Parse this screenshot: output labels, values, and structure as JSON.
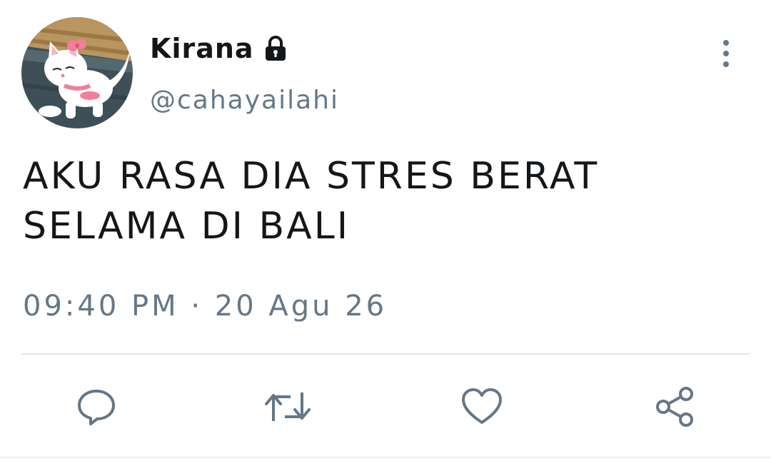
{
  "tweet": {
    "author": {
      "display_name": "Kirana",
      "handle": "@cahayailahi",
      "protected": true,
      "avatar": "white-cat-avatar"
    },
    "text_lines": [
      "AKU RASA DIA STRES BERAT",
      "SELAMA DI BALI"
    ],
    "time": "09:40 PM",
    "separator": "·",
    "date": "20 Agu 26",
    "actions": [
      "reply-icon",
      "retweet-icon",
      "like-icon",
      "share-icon"
    ]
  },
  "colors": {
    "text": "#14171a",
    "muted": "#657786",
    "divider": "#e1e8ed"
  }
}
